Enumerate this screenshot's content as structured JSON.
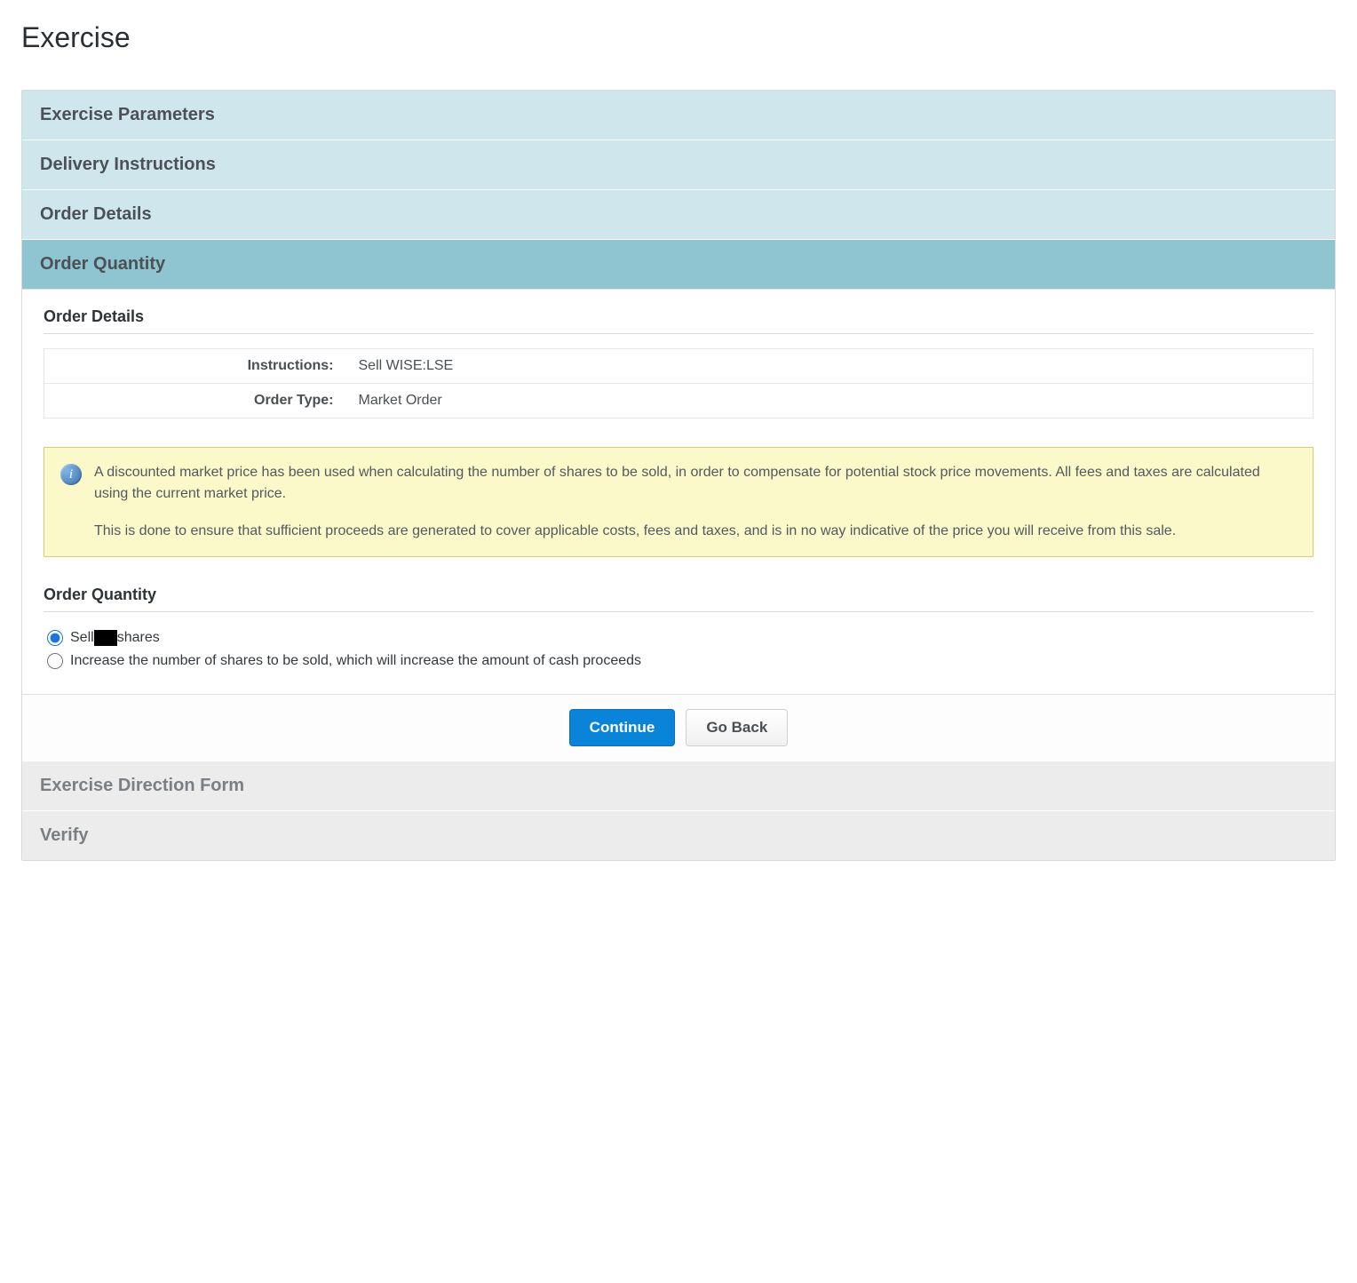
{
  "page": {
    "title": "Exercise"
  },
  "accordion": {
    "items": [
      {
        "label": "Exercise Parameters"
      },
      {
        "label": "Delivery Instructions"
      },
      {
        "label": "Order Details"
      },
      {
        "label": "Order Quantity"
      },
      {
        "label": "Exercise Direction Form"
      },
      {
        "label": "Verify"
      }
    ]
  },
  "body": {
    "order_details_heading": "Order Details",
    "details": {
      "instructions_label": "Instructions:",
      "instructions_value": "Sell WISE:LSE",
      "order_type_label": "Order Type:",
      "order_type_value": "Market Order"
    },
    "info": {
      "p1": "A discounted market price has been used when calculating the number of shares to be sold, in order to compensate for potential stock price movements. All fees and taxes are calculated using the current market price.",
      "p2": "This is done to ensure that sufficient proceeds are generated to cover applicable costs, fees and taxes, and is in no way indicative of the price you will receive from this sale."
    },
    "order_quantity_heading": "Order Quantity",
    "options": {
      "sell_prefix": "Sell",
      "sell_suffix": "shares",
      "increase_label": "Increase the number of shares to be sold, which will increase the amount of cash proceeds"
    }
  },
  "buttons": {
    "continue": "Continue",
    "go_back": "Go Back"
  }
}
